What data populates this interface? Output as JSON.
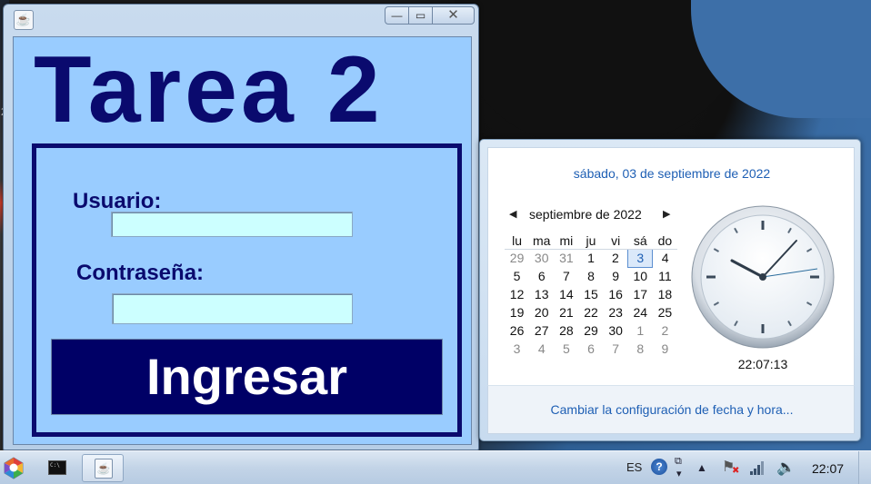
{
  "desktop": {
    "stray_text": "2"
  },
  "app_window": {
    "title_icon": "java-icon",
    "heading": "Tarea 2",
    "user_label": "Usuario:",
    "user_value": "",
    "password_label": "Contraseña:",
    "password_value": "",
    "submit_label": "Ingresar",
    "colors": {
      "background": "#99ccff",
      "heading": "#0a0a6e",
      "button": "#000066",
      "field": "#ccffff"
    }
  },
  "calendar": {
    "long_date": "sábado, 03 de septiembre de 2022",
    "month_label": "septiembre de 2022",
    "weekdays": [
      "lu",
      "ma",
      "mi",
      "ju",
      "vi",
      "sá",
      "do"
    ],
    "weeks": [
      [
        "29",
        "30",
        "31",
        "1",
        "2",
        "3",
        "4"
      ],
      [
        "5",
        "6",
        "7",
        "8",
        "9",
        "10",
        "11"
      ],
      [
        "12",
        "13",
        "14",
        "15",
        "16",
        "17",
        "18"
      ],
      [
        "19",
        "20",
        "21",
        "22",
        "23",
        "24",
        "25"
      ],
      [
        "26",
        "27",
        "28",
        "29",
        "30",
        "1",
        "2"
      ],
      [
        "3",
        "4",
        "5",
        "6",
        "7",
        "8",
        "9"
      ]
    ],
    "time": "22:07:13",
    "settings_link": "Cambiar la configuración de fecha y hora...",
    "selected_day": "3"
  },
  "taskbar": {
    "language": "ES",
    "clock": "22:07",
    "items": [
      "cmd-window",
      "java-app"
    ]
  }
}
